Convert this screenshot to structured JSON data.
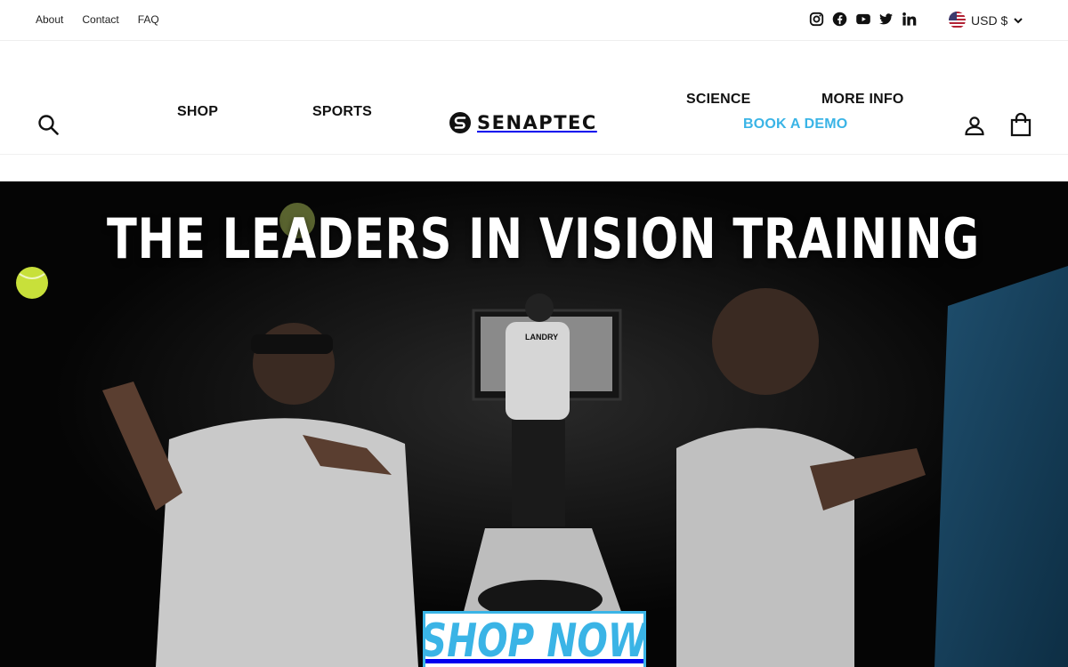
{
  "topbar": {
    "links": [
      "About",
      "Contact",
      "FAQ"
    ],
    "social_icons": [
      "instagram-icon",
      "facebook-icon",
      "youtube-icon",
      "twitter-icon",
      "linkedin-icon"
    ],
    "currency": "USD $"
  },
  "header": {
    "nav": {
      "shop": "SHOP",
      "sports": "SPORTS",
      "science": "SCIENCE",
      "more_info": "MORE INFO",
      "book_demo": "BOOK A DEMO"
    },
    "logo_text": "SENAPTEC",
    "icons": [
      "search-icon",
      "account-icon",
      "cart-icon"
    ]
  },
  "hero": {
    "title": "THE LEADERS IN VISION TRAINING",
    "cta": "SHOP NOW",
    "jersey_name": "LANDRY"
  },
  "colors": {
    "accent": "#3ab4e6",
    "hero_bg": "#050505",
    "text": "#111111"
  }
}
